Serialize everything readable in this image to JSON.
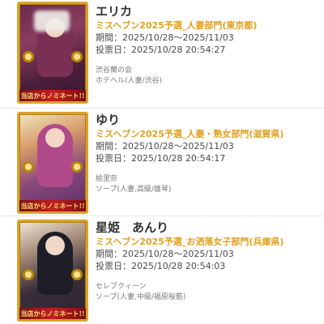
{
  "entries": [
    {
      "name": "エリカ",
      "award": "ミスヘブン2025予選_人妻部門(東京都)",
      "period": "期間：2025/10/28〜2025/11/03",
      "voted": "投票日：2025/10/28 20:54:27",
      "shop": "渋谷蘭の会",
      "category": "ホテヘル(人妻/渋谷)",
      "banner": "当店からノミネート!!"
    },
    {
      "name": "ゆり",
      "award": "ミスヘブン2025予選_人妻・熟女部門(滋賀県)",
      "period": "期間：2025/10/28〜2025/11/03",
      "voted": "投票日：2025/10/28 20:54:17",
      "shop": "絵里奈",
      "category": "ソープ(人妻,高級/雄琴)",
      "banner": "当店からノミネート!!"
    },
    {
      "name": "星姫　あんり",
      "award": "ミスヘブン2025予選_お洒落女子部門(兵庫県)",
      "period": "期間：2025/10/28〜2025/11/03",
      "voted": "投票日：2025/10/28 20:54:03",
      "shop": "セレブクィーン",
      "category": "ソープ(人妻,中級/福原桜筋)",
      "banner": "当店からノミネート!!"
    }
  ],
  "colors": {
    "award": "#e0a020",
    "frame": "#d9a32c"
  }
}
